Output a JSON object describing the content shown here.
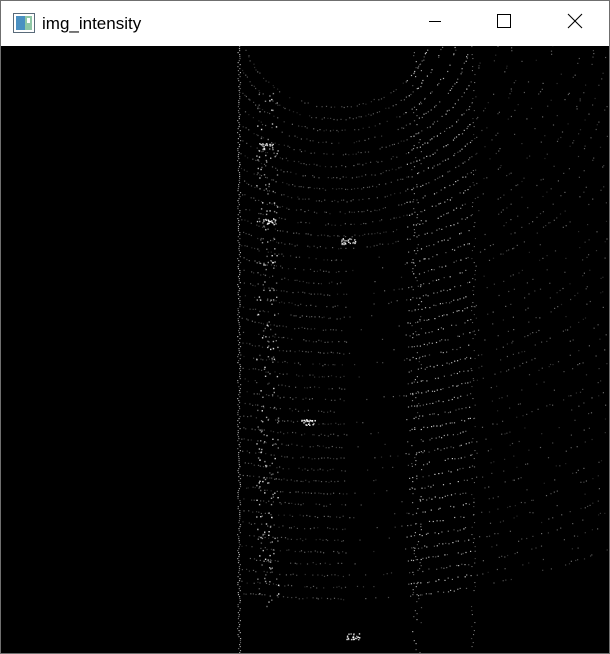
{
  "window": {
    "title": "img_intensity",
    "app_icon": "opencv-window-icon",
    "controls": {
      "minimize_icon": "minimize-icon",
      "maximize_icon": "maximize-icon",
      "close_icon": "close-icon"
    }
  },
  "image": {
    "description_kind": "lidar-intensity-birdseye",
    "background_color": "#000000",
    "point_color": "#ffffff"
  }
}
